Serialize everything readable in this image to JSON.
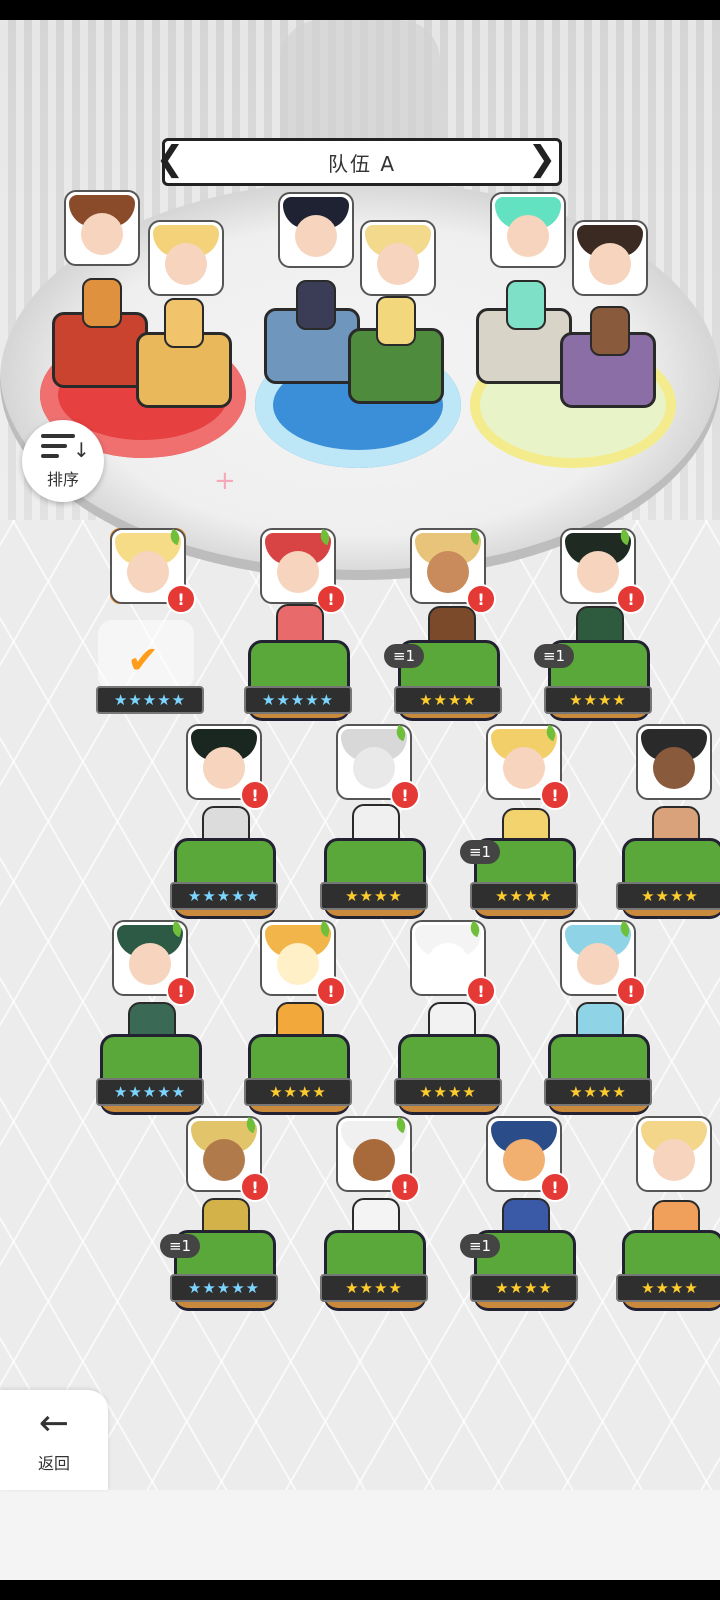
{
  "team": {
    "title": "队伍 A",
    "prev_arrow": "❮",
    "next_arrow": "❯"
  },
  "sort": {
    "label": "排序"
  },
  "back": {
    "label": "返回"
  },
  "icons": {
    "alert": "!",
    "check": "✔",
    "back": "←"
  },
  "colors": {
    "accent_orange": "#f28c1e",
    "alert_red": "#e53935",
    "star_gold": "#ffcc2e",
    "star_rainbow": "#7cd5ff",
    "ring_red": "#e64040",
    "ring_blue": "#3a8fd8",
    "ring_yellow": "#f4eb8d"
  },
  "roster": [
    {
      "stars": "★★★★★",
      "level": "",
      "selected": true
    },
    {
      "stars": "★★★★★",
      "level": ""
    },
    {
      "stars": "★★★★",
      "level": "1"
    },
    {
      "stars": "★★★★",
      "level": "1"
    },
    {
      "stars": "★★★★★",
      "level": ""
    },
    {
      "stars": "★★★★",
      "level": ""
    },
    {
      "stars": "★★★★",
      "level": "1"
    },
    {
      "stars": "★★★★",
      "level": ""
    },
    {
      "stars": "★★★★★",
      "level": ""
    },
    {
      "stars": "★★★★",
      "level": ""
    },
    {
      "stars": "★★★★",
      "level": ""
    },
    {
      "stars": "★★★★",
      "level": ""
    },
    {
      "stars": "★★★★★",
      "level": "1"
    },
    {
      "stars": "★★★★",
      "level": ""
    },
    {
      "stars": "★★★★",
      "level": "1"
    },
    {
      "stars": "★★★★",
      "level": ""
    }
  ]
}
